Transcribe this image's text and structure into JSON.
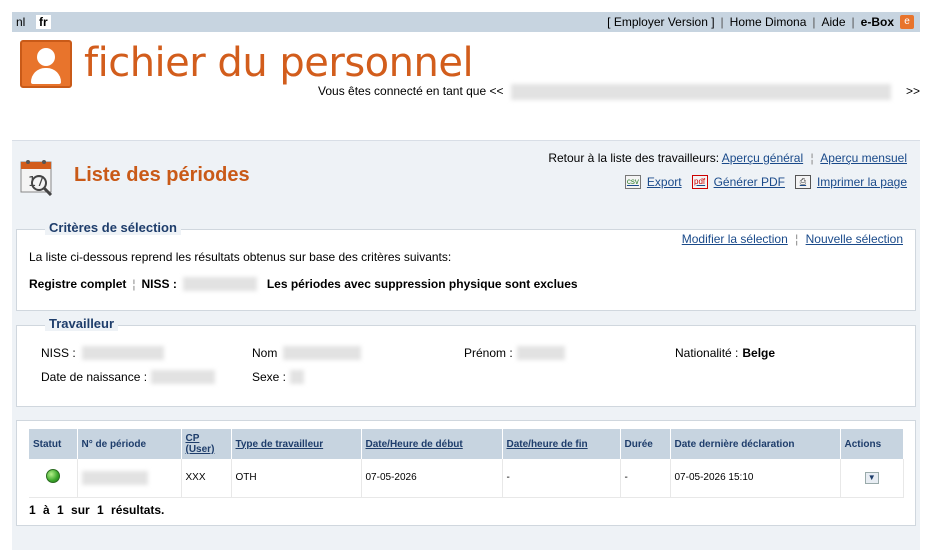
{
  "topbar": {
    "lang_nl": "nl",
    "lang_fr": "fr",
    "links": [
      "[ Employer Version ]",
      "Home Dimona",
      "Aide"
    ],
    "ebox": "e-Box",
    "ebox_icon": "e"
  },
  "header": {
    "title": "fichier du personnel",
    "connected_prefix": "Vous êtes connecté en tant que <<",
    "connected_suffix": ">>"
  },
  "page": {
    "title": "Liste des périodes",
    "retour_label": "Retour à la liste des travailleurs:",
    "apercu_general": "Aperçu général",
    "apercu_mensuel": "Aperçu mensuel",
    "export": "Export",
    "generer_pdf": "Générer PDF",
    "imprimer": "Imprimer la page",
    "calendar_day": "17"
  },
  "criteres": {
    "legend": "Critères de sélection",
    "modifier": "Modifier la sélection",
    "nouvelle": "Nouvelle sélection",
    "intro": "La liste ci-dessous reprend les résultats obtenus sur base des critères suivants:",
    "registre": "Registre complet",
    "niss_label": "NISS :",
    "exclues": "Les périodes avec suppression physique sont exclues"
  },
  "travailleur": {
    "legend": "Travailleur",
    "niss_label": "NISS :",
    "nom_label": "Nom",
    "prenom_label": "Prénom :",
    "nationalite_label": "Nationalité :",
    "nationalite_value": "Belge",
    "naissance_label": "Date de naissance :",
    "sexe_label": "Sexe :"
  },
  "table": {
    "headers": {
      "statut": "Statut",
      "periode": "N° de période",
      "cp": "CP (User)",
      "type": "Type de travailleur",
      "debut": "Date/Heure de début",
      "fin": "Date/heure de fin",
      "duree": "Durée",
      "derniere": "Date dernière déclaration",
      "actions": "Actions"
    },
    "rows": [
      {
        "cp": "XXX",
        "type": "OTH",
        "debut": "07-05-2026",
        "fin": "-",
        "duree": "-",
        "derniere": "07-05-2026 15:10"
      }
    ],
    "results": "1 à 1 sur 1 résultats."
  },
  "colors": {
    "brand_orange": "#d25d1c",
    "header_blue": "#c7d4e0",
    "link_blue": "#1a4a8a"
  }
}
